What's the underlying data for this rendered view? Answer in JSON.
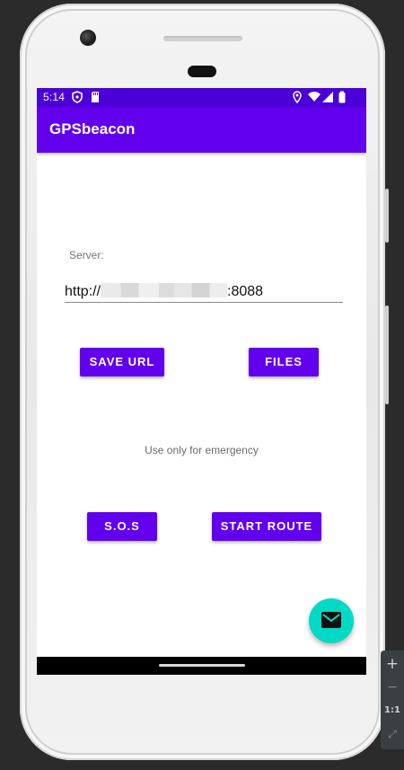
{
  "status_bar": {
    "time": "5:14",
    "icons_left": [
      "shield-icon",
      "sd-card-icon"
    ],
    "icons_right": [
      "location-icon",
      "wifi-icon",
      "signal-icon",
      "battery-icon"
    ]
  },
  "app_bar": {
    "title": "GPSbeacon",
    "color": "#6200ee",
    "status_color": "#4a00d6"
  },
  "form": {
    "server_label": "Server:",
    "url_prefix": "http://",
    "url_suffix": ":8088"
  },
  "buttons": {
    "save_url": "SAVE URL",
    "files": "FILES",
    "sos": "S.O.S",
    "start_route": "START ROUTE"
  },
  "hint_text": "Use only for emergency",
  "fab": {
    "icon": "mail-icon",
    "color": "#03dac5"
  },
  "emulator_toolbar": {
    "items": [
      "+",
      "−",
      "1:1",
      "⤢"
    ]
  }
}
